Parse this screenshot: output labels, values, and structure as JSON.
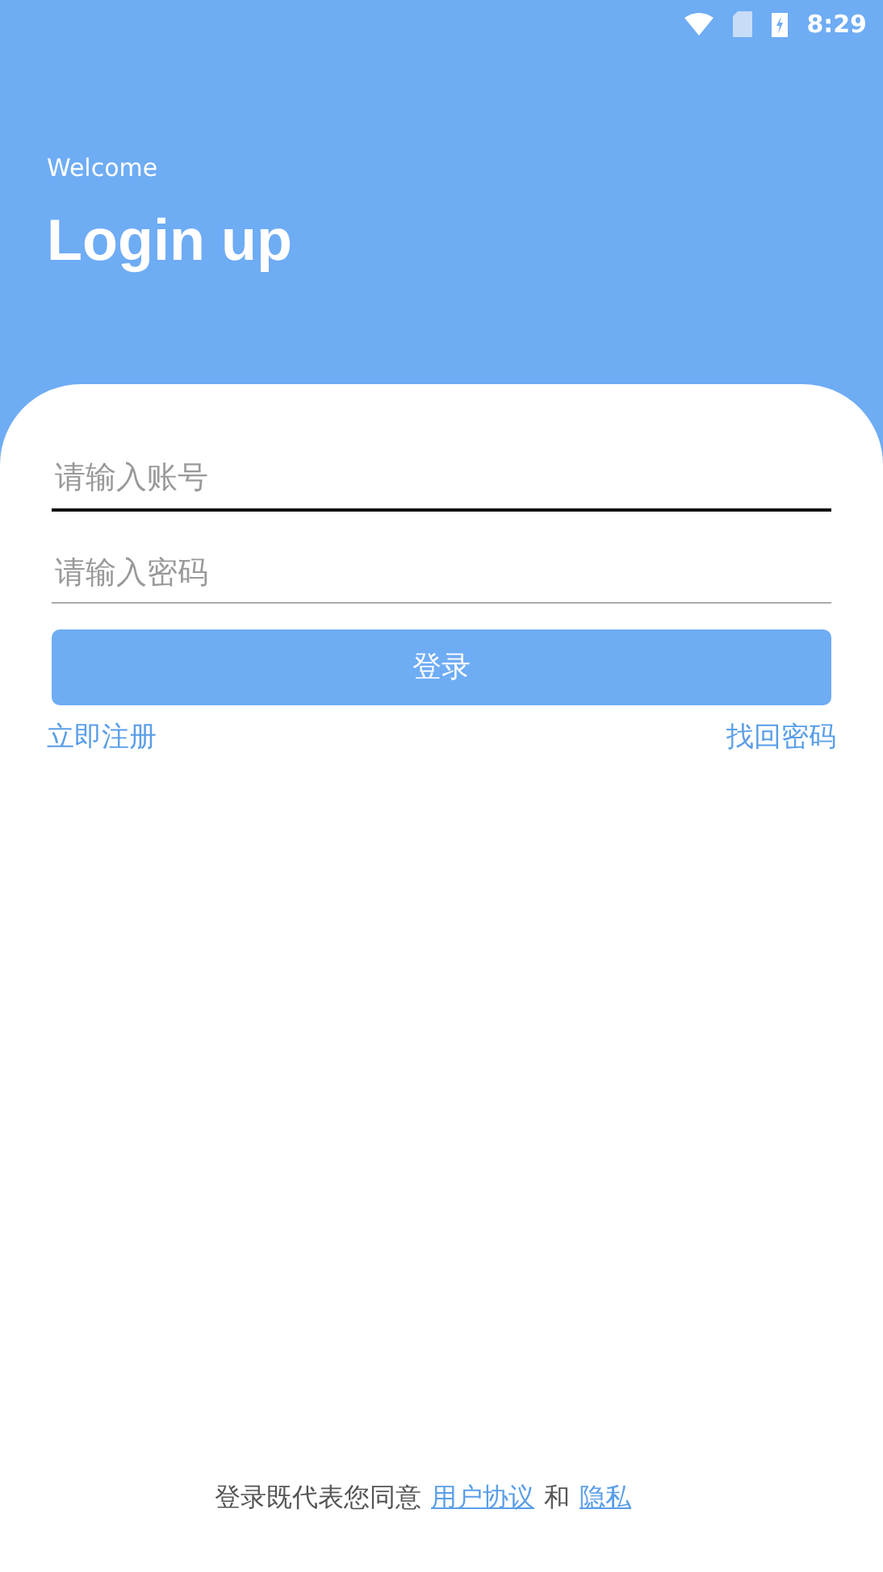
{
  "status_bar": {
    "time": "8:29"
  },
  "header": {
    "subtitle": "Welcome",
    "title": "Login up"
  },
  "fields": [
    {
      "placeholder": "请输入账号",
      "focused": true
    },
    {
      "placeholder": "请输入密码",
      "focused": false
    }
  ],
  "login_button": "登录",
  "links": [
    "立即注册",
    "找回密码"
  ],
  "footer": {
    "text": "登录既代表您同意",
    "links": [
      "用户协议",
      "隐私"
    ],
    "joiner": "和"
  }
}
